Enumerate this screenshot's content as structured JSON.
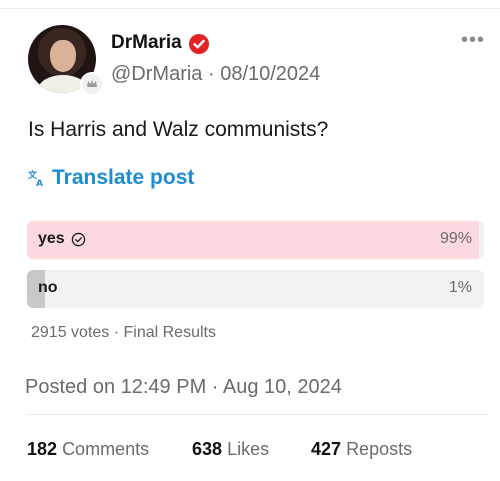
{
  "author": {
    "name": "DrMaria",
    "handle": "@DrMaria",
    "date": "08/10/2024",
    "verified_color": "#e02424"
  },
  "post": {
    "text": "Is Harris and Walz communists?",
    "translate_label": "Translate post"
  },
  "poll": {
    "options": [
      {
        "label": "yes",
        "percent_text": "99%",
        "percent": 99,
        "selected": true
      },
      {
        "label": "no",
        "percent_text": "1%",
        "percent": 1,
        "selected": false
      }
    ],
    "summary": "2915 votes · Final Results"
  },
  "meta": {
    "posted": "Posted on 12:49 PM · Aug 10, 2024"
  },
  "stats": {
    "comments_count": "182",
    "comments_label": "Comments",
    "likes_count": "638",
    "likes_label": "Likes",
    "reposts_count": "427",
    "reposts_label": "Reposts"
  },
  "colors": {
    "accent": "#1d8cd6",
    "yes_fill": "#fbd9de",
    "no_fill": "#c8c8c8"
  }
}
